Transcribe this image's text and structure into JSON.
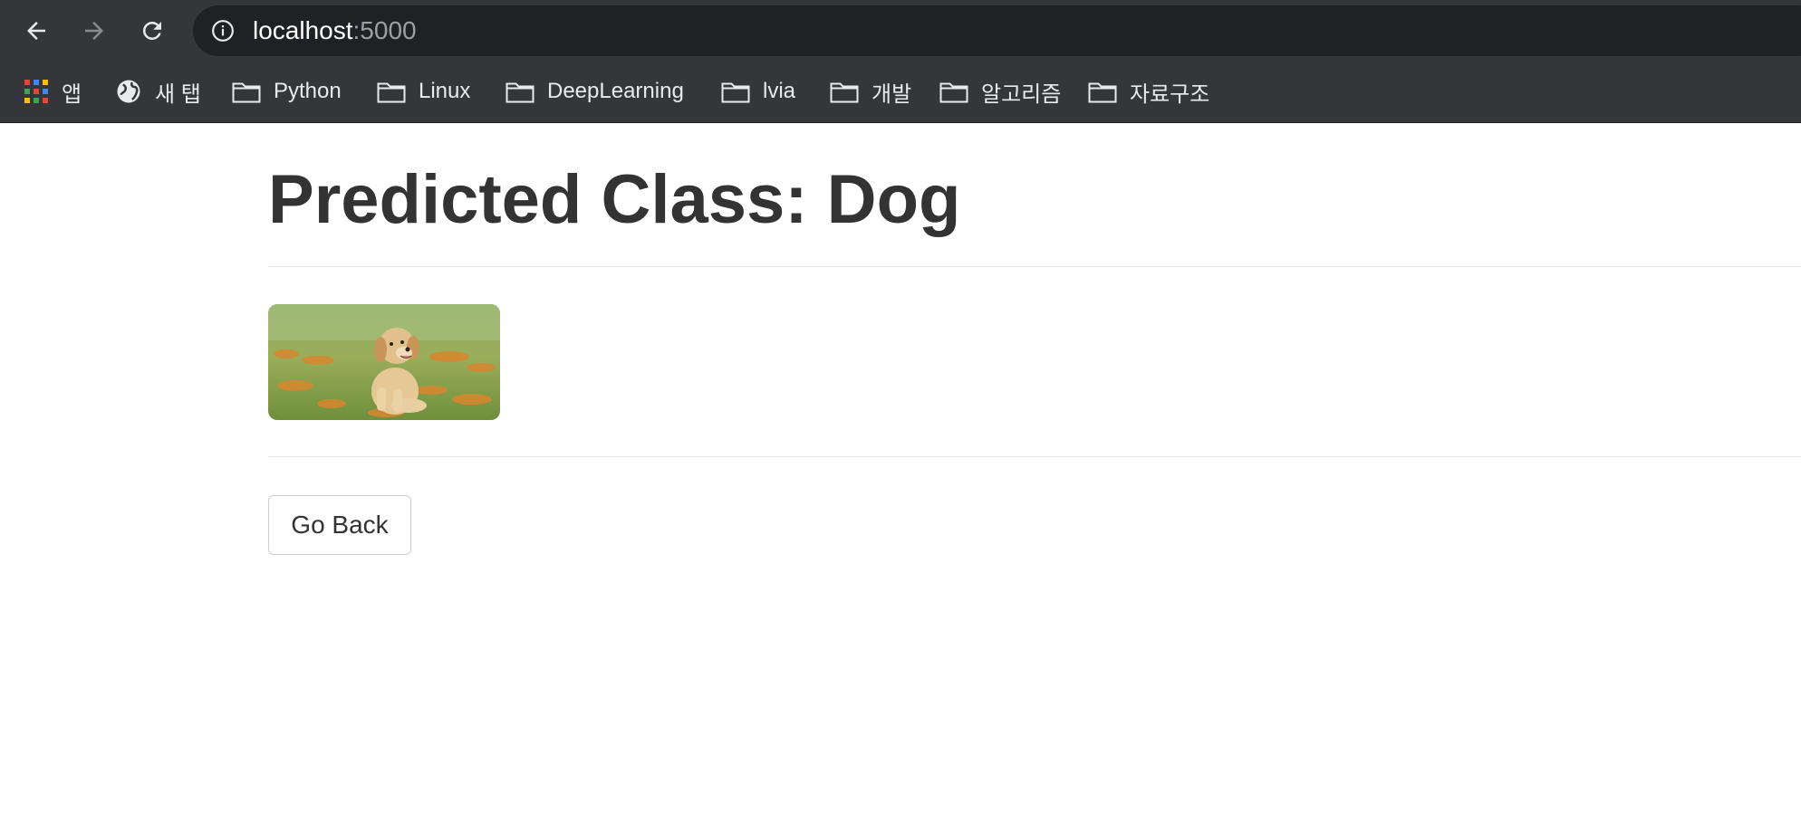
{
  "browser": {
    "url_host": "localhost",
    "url_port": ":5000",
    "back_icon": "arrow-left-icon",
    "forward_icon": "arrow-right-icon",
    "reload_icon": "reload-icon",
    "info_icon": "info-icon"
  },
  "bookmarks": {
    "items": [
      {
        "label": "앱",
        "icon": "apps-grid-icon"
      },
      {
        "label": "새 탭",
        "icon": "globe-icon"
      },
      {
        "label": "Python",
        "icon": "folder-icon"
      },
      {
        "label": "Linux",
        "icon": "folder-icon"
      },
      {
        "label": "DeepLearning",
        "icon": "folder-icon"
      },
      {
        "label": "lvia",
        "icon": "folder-icon"
      },
      {
        "label": "개발",
        "icon": "folder-icon"
      },
      {
        "label": "알고리즘",
        "icon": "folder-icon"
      },
      {
        "label": "자료구조",
        "icon": "folder-icon"
      }
    ]
  },
  "page": {
    "title": "Predicted Class: Dog",
    "image_subject": "golden retriever puppy sitting on grass",
    "back_button_label": "Go Back"
  },
  "colors": {
    "chrome_bg": "#35363a",
    "omnibox_bg": "#202124",
    "text_dark": "#333333",
    "divider": "#e5e5e5"
  }
}
